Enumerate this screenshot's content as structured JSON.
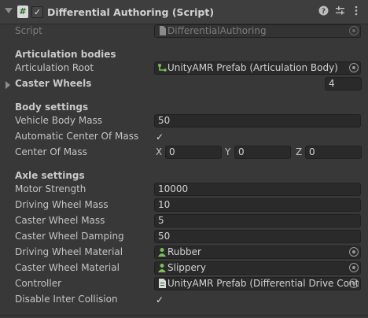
{
  "component": {
    "title": "Differential Authoring (Script)",
    "icons": [
      "help-icon",
      "presets-icon",
      "more-icon"
    ]
  },
  "script": {
    "label": "Script",
    "value": "DifferentialAuthoring"
  },
  "articulation": {
    "section": "Articulation bodies",
    "root_label": "Articulation Root",
    "root_value": "UnityAMR Prefab (Articulation Body)",
    "caster_label": "Caster Wheels",
    "caster_count": "4"
  },
  "body": {
    "section": "Body settings",
    "mass_label": "Vehicle Body Mass",
    "mass_value": "50",
    "auto_com_label": "Automatic Center Of Mass",
    "auto_com_checked": true,
    "com_label": "Center Of Mass",
    "com": {
      "x_label": "X",
      "x": "0",
      "y_label": "Y",
      "y": "0",
      "z_label": "Z",
      "z": "0"
    }
  },
  "axle": {
    "section": "Axle settings",
    "rows": [
      {
        "label": "Motor Strength",
        "value": "10000"
      },
      {
        "label": "Driving Wheel Mass",
        "value": "10"
      },
      {
        "label": "Caster Wheel Mass",
        "value": "5"
      },
      {
        "label": "Caster Wheel Damping",
        "value": "50"
      }
    ],
    "driving_material_label": "Driving Wheel Material",
    "driving_material_value": "Rubber",
    "caster_material_label": "Caster Wheel Material",
    "caster_material_value": "Slippery",
    "controller_label": "Controller",
    "controller_value": "UnityAMR Prefab (Differential Drive Cont",
    "disable_collision_label": "Disable Inter Collision",
    "disable_collision_checked": true
  },
  "check_glyph": "✓"
}
